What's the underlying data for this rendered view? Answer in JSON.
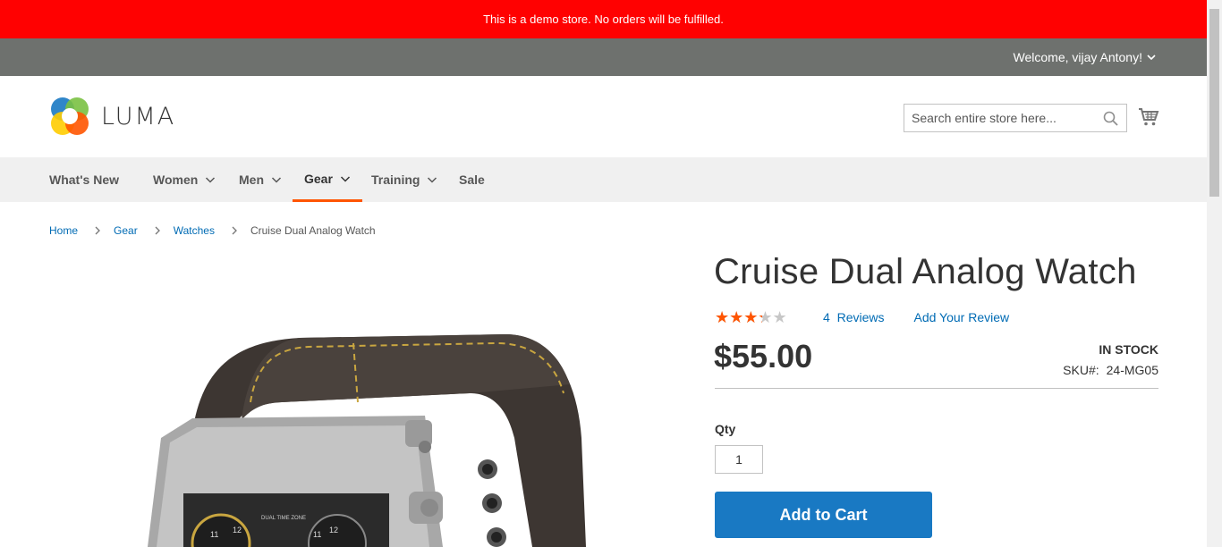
{
  "notice": {
    "text": "This is a demo store. No orders will be fulfilled."
  },
  "header": {
    "welcome": "Welcome, vijay Antony!",
    "logo_text": "LUMA",
    "search": {
      "placeholder": "Search entire store here..."
    }
  },
  "nav": {
    "items": [
      {
        "label": "What's New",
        "has_dropdown": false
      },
      {
        "label": "Women",
        "has_dropdown": true
      },
      {
        "label": "Men",
        "has_dropdown": true
      },
      {
        "label": "Gear",
        "has_dropdown": true,
        "active": true
      },
      {
        "label": "Training",
        "has_dropdown": true
      },
      {
        "label": "Sale",
        "has_dropdown": false
      }
    ]
  },
  "breadcrumbs": [
    "Home",
    "Gear",
    "Watches",
    "Cruise Dual Analog Watch"
  ],
  "product": {
    "title": "Cruise Dual Analog Watch",
    "rating_percent": 60,
    "reviews_count": "4",
    "reviews_label": "Reviews",
    "add_review": "Add Your Review",
    "price": "$55.00",
    "stock": "IN STOCK",
    "sku_label": "SKU#:",
    "sku_value": "24-MG05",
    "qty_label": "Qty",
    "qty_value": "1",
    "add_to_cart": "Add to Cart",
    "image_text": "DUAL TIME ZONE"
  },
  "colors": {
    "notice_bg": "#ff0101",
    "panel_bg": "#6e716e",
    "accent": "#ff5501",
    "link": "#006bb4",
    "primary_button": "#1979c3"
  }
}
